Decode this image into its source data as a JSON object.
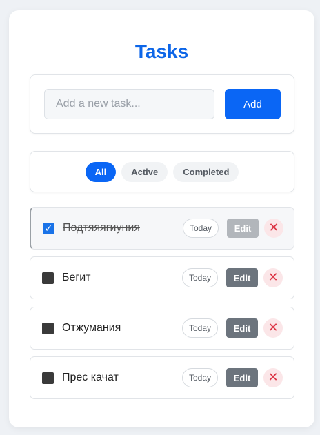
{
  "header": {
    "title": "Tasks"
  },
  "add_form": {
    "placeholder": "Add a new task...",
    "value": "",
    "add_label": "Add"
  },
  "filters": [
    {
      "label": "All",
      "active": true
    },
    {
      "label": "Active",
      "active": false
    },
    {
      "label": "Completed",
      "active": false
    }
  ],
  "tasks": [
    {
      "text": "Подтяяягиуния",
      "completed": true,
      "date": "Today",
      "edit_label": "Edit",
      "delete_icon": "close-icon"
    },
    {
      "text": "Бегит",
      "completed": false,
      "date": "Today",
      "edit_label": "Edit",
      "delete_icon": "close-icon"
    },
    {
      "text": "Отжумания",
      "completed": false,
      "date": "Today",
      "edit_label": "Edit",
      "delete_icon": "close-icon"
    },
    {
      "text": "Прес качат",
      "completed": false,
      "date": "Today",
      "edit_label": "Edit",
      "delete_icon": "close-icon"
    }
  ],
  "colors": {
    "accent": "#0a66f5",
    "delete": "#dc3545",
    "edit": "#6c747d"
  }
}
